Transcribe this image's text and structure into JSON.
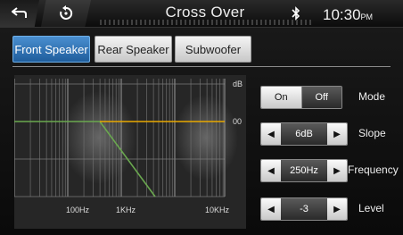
{
  "header": {
    "title": "Cross Over",
    "time": "10:30",
    "time_suffix": "PM"
  },
  "tabs": [
    {
      "label": "Front Speaker",
      "active": true
    },
    {
      "label": "Rear Speaker",
      "active": false
    },
    {
      "label": "Subwoofer",
      "active": false
    }
  ],
  "graph": {
    "unit_label": "dB",
    "ref_label": "00",
    "x_labels": [
      "100Hz",
      "1KHz",
      "10KHz"
    ],
    "colors": {
      "flat_line": "#e8a800",
      "rolloff_line": "#6aa84f"
    }
  },
  "controls": {
    "mode": {
      "on_label": "On",
      "off_label": "Off",
      "label": "Mode",
      "selected": "On"
    },
    "slope": {
      "value": "6dB",
      "label": "Slope"
    },
    "frequency": {
      "value": "250Hz",
      "label": "Frequency"
    },
    "level": {
      "value": "-3",
      "label": "Level"
    }
  }
}
